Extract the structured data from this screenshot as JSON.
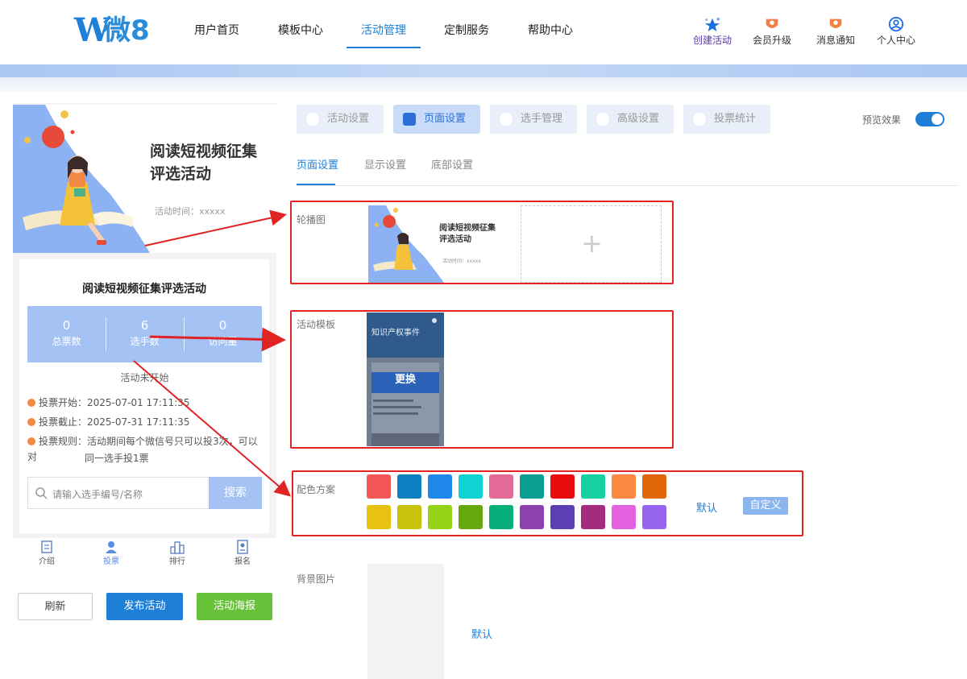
{
  "brand": {
    "logo_text": "微8",
    "logo_letter": "W"
  },
  "nav": {
    "items": [
      "用户首页",
      "模板中心",
      "活动管理",
      "定制服务",
      "帮助中心"
    ],
    "active": "活动管理"
  },
  "tools": {
    "create": "创建活动",
    "upgrade": "会员升级",
    "notify": "消息通知",
    "profile": "个人中心"
  },
  "preview_panel": {
    "banner_title_line1": "阅读短视频征集",
    "banner_title_line2": "评选活动",
    "banner_time": "活动时间：xxxxx",
    "activity_title": "阅读短视频征集评选活动",
    "stats": [
      {
        "value": "0",
        "label": "总票数"
      },
      {
        "value": "6",
        "label": "选手数"
      },
      {
        "value": "0",
        "label": "访问量"
      }
    ],
    "status": "活动未开始",
    "vote_start": "投票开始：2025-07-01 17:11:35",
    "vote_end": "投票截止：2025-07-31 17:11:35",
    "vote_rule_line1": "投票规则：活动期间每个微信号只可以投3次，可以对",
    "vote_rule_line2": "同一选手投1票",
    "search_placeholder": "请输入选手编号/名称",
    "search_button": "搜索",
    "tabbar": [
      {
        "label": "介绍",
        "icon": "intro-icon"
      },
      {
        "label": "投票",
        "icon": "vote-icon"
      },
      {
        "label": "排行",
        "icon": "rank-icon"
      },
      {
        "label": "报名",
        "icon": "signup-icon"
      }
    ],
    "tabbar_active": "投票",
    "buttons": {
      "refresh": "刷新",
      "publish": "发布活动",
      "poster": "活动海报"
    }
  },
  "settings": {
    "top_tabs": [
      "活动设置",
      "页面设置",
      "选手管理",
      "高级设置",
      "投票统计"
    ],
    "top_active": "页面设置",
    "preview_label": "预览效果",
    "preview_on": true,
    "sub_tabs": [
      "页面设置",
      "显示设置",
      "底部设置"
    ],
    "sub_active": "页面设置",
    "carousel_label": "轮播图",
    "carousel_thumb_title1": "阅读短视频征集",
    "carousel_thumb_title2": "评选活动",
    "carousel_thumb_time": "活动时间：xxxxx",
    "template_label": "活动模板",
    "template_thumb_title": "知识产权事件",
    "template_change": "更换",
    "color_label": "配色方案",
    "colors": [
      "#f35654",
      "#0b80c0",
      "#1e87ea",
      "#0fd2d2",
      "#e46a9a",
      "#0a9e90",
      "#e80c0c",
      "#16d0a2",
      "#fb8a40",
      "#e06608",
      "#e8c213",
      "#c8c30a",
      "#96d316",
      "#63a80d",
      "#07b07b",
      "#8e3fb0",
      "#5b3fb3",
      "#a32c7c",
      "#e561e0",
      "#9764f0"
    ],
    "color_default": "默认",
    "color_custom": "自定义",
    "bg_label": "背景图片",
    "bg_default": "默认"
  },
  "colors": {
    "accent": "#1e7fd6",
    "stat_bg": "#a5c2f5",
    "publish": "#1e7fd6",
    "poster": "#67c23a",
    "highlight_red": "#e02323"
  }
}
